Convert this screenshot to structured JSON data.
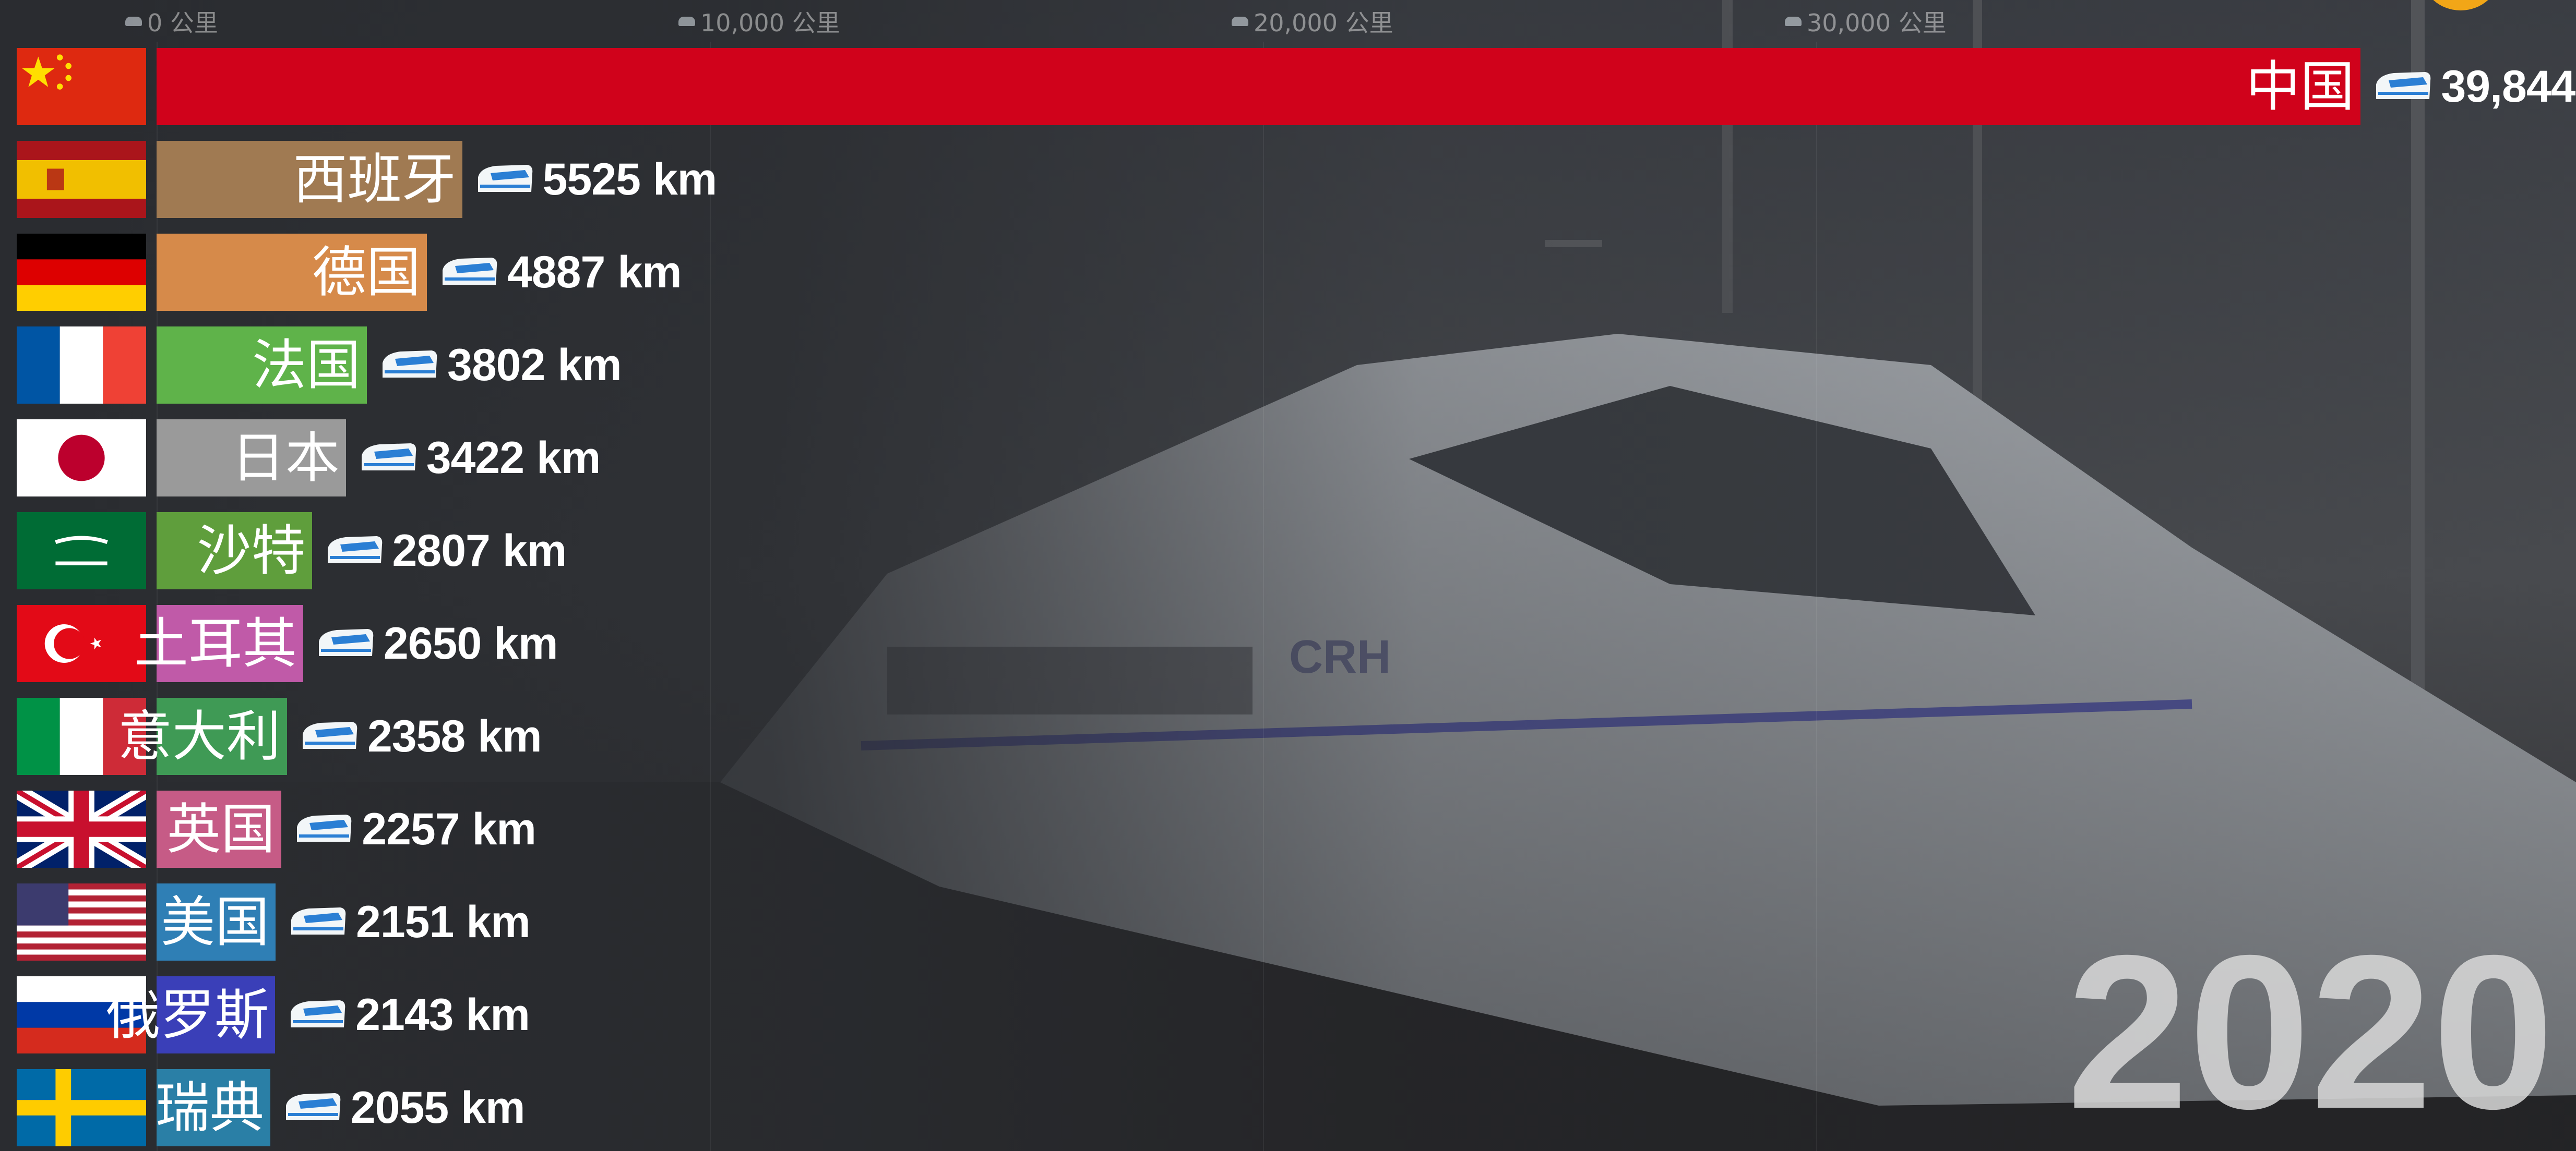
{
  "chart_data": {
    "type": "bar",
    "orientation": "horizontal",
    "axis": {
      "ticks": [
        0,
        10000,
        20000,
        30000
      ],
      "tick_labels": [
        "0 公里",
        "10,000 公里",
        "20,000 公里",
        "30,000 公里"
      ],
      "xlim": [
        0,
        40000
      ]
    },
    "unit": "km",
    "year": "2020",
    "bars": [
      {
        "label": "中国",
        "value": 39844,
        "value_text": "39,844",
        "color": "#d0021b",
        "flag": "china"
      },
      {
        "label": "西班牙",
        "value": 5525,
        "value_text": "5525",
        "color": "#a07a52",
        "flag": "spain"
      },
      {
        "label": "德国",
        "value": 4887,
        "value_text": "4887",
        "color": "#d68a4a",
        "flag": "germany"
      },
      {
        "label": "法国",
        "value": 3802,
        "value_text": "3802",
        "color": "#5fb34a",
        "flag": "france"
      },
      {
        "label": "日本",
        "value": 3422,
        "value_text": "3422",
        "color": "#9a9a9a",
        "flag": "japan"
      },
      {
        "label": "沙特",
        "value": 2807,
        "value_text": "2807",
        "color": "#5f9e3c",
        "flag": "saudi"
      },
      {
        "label": "土耳其",
        "value": 2650,
        "value_text": "2650",
        "color": "#c05aa8",
        "flag": "turkey"
      },
      {
        "label": "意大利",
        "value": 2358,
        "value_text": "2358",
        "color": "#3f9a55",
        "flag": "italy"
      },
      {
        "label": "英国",
        "value": 2257,
        "value_text": "2257",
        "color": "#c65b86",
        "flag": "uk"
      },
      {
        "label": "美国",
        "value": 2151,
        "value_text": "2151",
        "color": "#2f7fb5",
        "flag": "usa"
      },
      {
        "label": "俄罗斯",
        "value": 2143,
        "value_text": "2143",
        "color": "#3a3fb8",
        "flag": "russia"
      },
      {
        "label": "瑞典",
        "value": 2055,
        "value_text": "2055",
        "color": "#2a7fa6",
        "flag": "sweden"
      }
    ]
  }
}
